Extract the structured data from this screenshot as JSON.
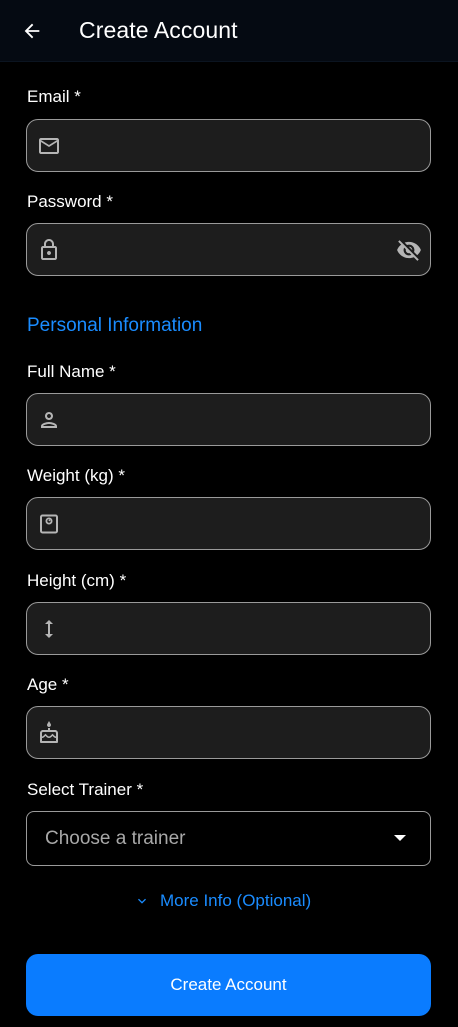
{
  "appbar": {
    "title": "Create Account"
  },
  "form": {
    "email": {
      "label": "Email *",
      "value": "",
      "icon": "mail-icon"
    },
    "password": {
      "label": "Password *",
      "value": "",
      "icon": "lock-icon",
      "toggle_icon": "eye-off-icon"
    },
    "section_title": "Personal Information",
    "full_name": {
      "label": "Full Name *",
      "value": "",
      "icon": "person-icon"
    },
    "weight": {
      "label": "Weight (kg) *",
      "value": "",
      "icon": "scale-icon"
    },
    "height": {
      "label": "Height (cm) *",
      "value": "",
      "icon": "height-icon"
    },
    "age": {
      "label": "Age *",
      "value": "",
      "icon": "cake-icon"
    },
    "trainer": {
      "label": "Select Trainer *",
      "placeholder": "Choose a trainer"
    },
    "more_info": "More Info (Optional)",
    "submit_label": "Create Account"
  },
  "colors": {
    "accent": "#0a7cff",
    "link": "#1a8cff",
    "field_bg": "#1d1d1d",
    "border": "#9a9a9a"
  }
}
